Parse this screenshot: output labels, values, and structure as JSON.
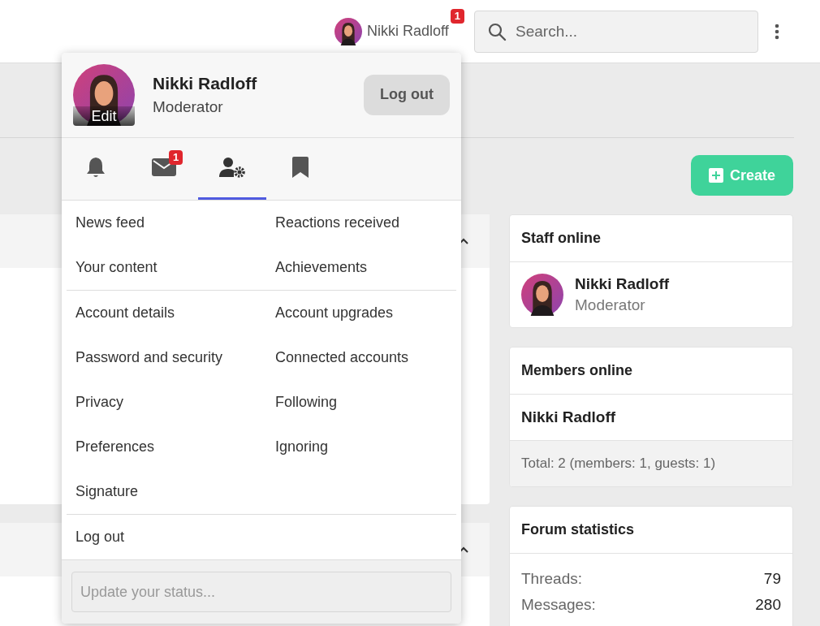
{
  "header": {
    "user": {
      "name": "Nikki Radloff",
      "badge": "1"
    },
    "search": {
      "placeholder": "Search..."
    }
  },
  "create_button": {
    "label": "Create"
  },
  "account_menu": {
    "name": "Nikki Radloff",
    "role": "Moderator",
    "avatar_label": "Edit",
    "logout_button": "Log out",
    "tabs": [
      {
        "kind": "bell",
        "selected": false
      },
      {
        "kind": "mail",
        "badge": "1",
        "selected": false
      },
      {
        "kind": "account",
        "selected": true
      },
      {
        "kind": "bookmark",
        "selected": false
      }
    ],
    "sections": [
      [
        "News feed",
        "Reactions received",
        "Your content",
        "Achievements"
      ],
      [
        "Account details",
        "Account upgrades",
        "Password and security",
        "Connected accounts",
        "Privacy",
        "Following",
        "Preferences",
        "Ignoring",
        "Signature"
      ],
      [
        "Log out"
      ]
    ],
    "status": {
      "placeholder": "Update your status..."
    }
  },
  "sidebar": {
    "staff_online": {
      "title": "Staff online",
      "members": [
        {
          "name": "Nikki Radloff",
          "role": "Moderator"
        }
      ]
    },
    "members_online": {
      "title": "Members online",
      "names": [
        "Nikki Radloff"
      ],
      "total": "Total: 2 (members: 1, guests: 1)"
    },
    "forum_statistics": {
      "title": "Forum statistics",
      "rows": [
        {
          "label": "Threads:",
          "value": "79"
        },
        {
          "label": "Messages:",
          "value": "280"
        }
      ]
    }
  }
}
